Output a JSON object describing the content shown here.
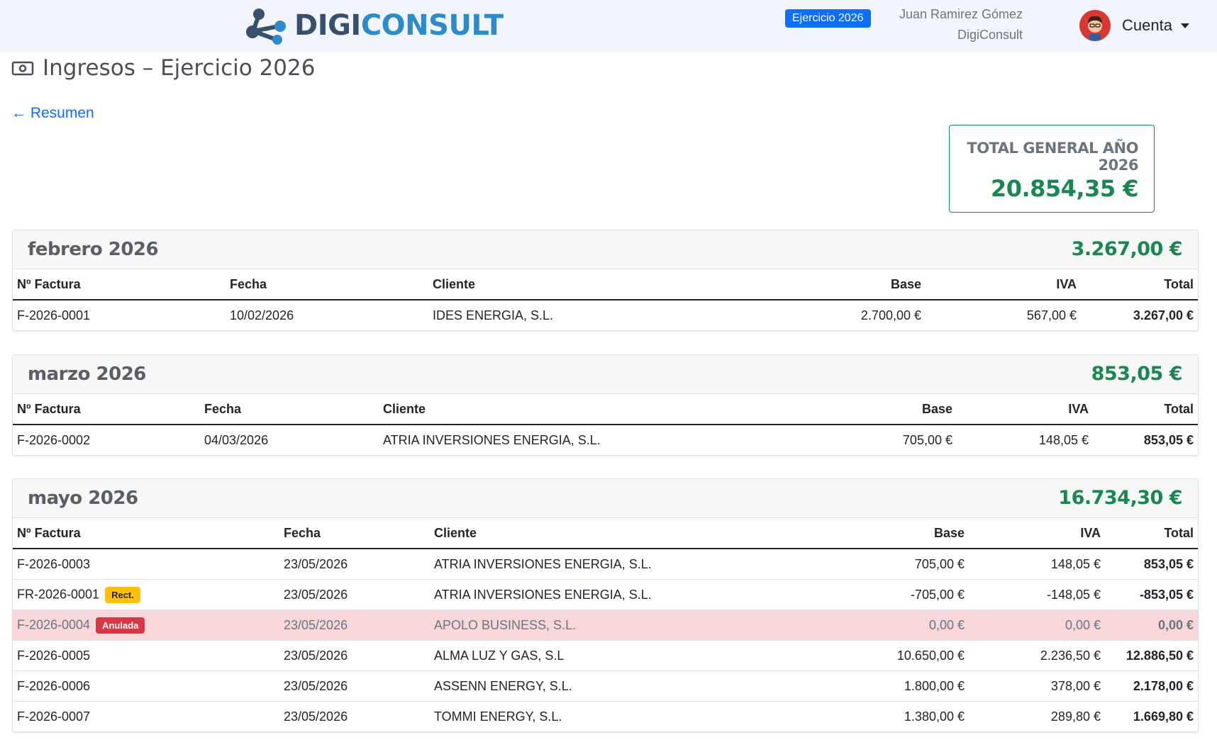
{
  "header": {
    "brand_part1": "DIGI",
    "brand_part2": "CONSULT",
    "year_badge": "Ejercicio 2026",
    "user_name": "Juan Ramirez Gómez",
    "user_company": "DigiConsult",
    "account_label": "Cuenta"
  },
  "page": {
    "title": "Ingresos – Ejercicio 2026",
    "back_link": "← Resumen"
  },
  "total_card": {
    "label": "TOTAL GENERAL AÑO 2026",
    "value": "20.854,35 €"
  },
  "colors": {
    "accent": "#0d6efd",
    "success": "#198754",
    "warning_badge": "#ffc107",
    "danger_badge": "#dc3545",
    "anulada_row": "#f8d7da"
  },
  "columns": [
    "Nº Factura",
    "Fecha",
    "Cliente",
    "Base",
    "IVA",
    "Total"
  ],
  "months": [
    {
      "name": "febrero 2026",
      "total": "3.267,00 €",
      "rows": [
        {
          "factura": "F-2026-0001",
          "badge": "",
          "fecha": "10/02/2026",
          "cliente": "IDES ENERGIA, S.L.",
          "base": "2.700,00 €",
          "iva": "567,00 €",
          "total": "3.267,00 €"
        }
      ]
    },
    {
      "name": "marzo 2026",
      "total": "853,05 €",
      "rows": [
        {
          "factura": "F-2026-0002",
          "badge": "",
          "fecha": "04/03/2026",
          "cliente": "ATRIA INVERSIONES ENERGIA, S.L.",
          "base": "705,00 €",
          "iva": "148,05 €",
          "total": "853,05 €"
        }
      ]
    },
    {
      "name": "mayo 2026",
      "total": "16.734,30 €",
      "rows": [
        {
          "factura": "F-2026-0003",
          "badge": "",
          "fecha": "23/05/2026",
          "cliente": "ATRIA INVERSIONES ENERGIA, S.L.",
          "base": "705,00 €",
          "iva": "148,05 €",
          "total": "853,05 €"
        },
        {
          "factura": "FR-2026-0001",
          "badge": "Rect.",
          "fecha": "23/05/2026",
          "cliente": "ATRIA INVERSIONES ENERGIA, S.L.",
          "base": "-705,00 €",
          "iva": "-148,05 €",
          "total": "-853,05 €"
        },
        {
          "factura": "F-2026-0004",
          "badge": "Anulada",
          "fecha": "23/05/2026",
          "cliente": "APOLO BUSINESS, S.L.",
          "base": "0,00 €",
          "iva": "0,00 €",
          "total": "0,00 €"
        },
        {
          "factura": "F-2026-0005",
          "badge": "",
          "fecha": "23/05/2026",
          "cliente": "ALMA LUZ Y GAS, S.L",
          "base": "10.650,00 €",
          "iva": "2.236,50 €",
          "total": "12.886,50 €"
        },
        {
          "factura": "F-2026-0006",
          "badge": "",
          "fecha": "23/05/2026",
          "cliente": "ASSENN ENERGY, S.L.",
          "base": "1.800,00 €",
          "iva": "378,00 €",
          "total": "2.178,00 €"
        },
        {
          "factura": "F-2026-0007",
          "badge": "",
          "fecha": "23/05/2026",
          "cliente": "TOMMI ENERGY, S.L.",
          "base": "1.380,00 €",
          "iva": "289,80 €",
          "total": "1.669,80 €"
        }
      ]
    }
  ]
}
